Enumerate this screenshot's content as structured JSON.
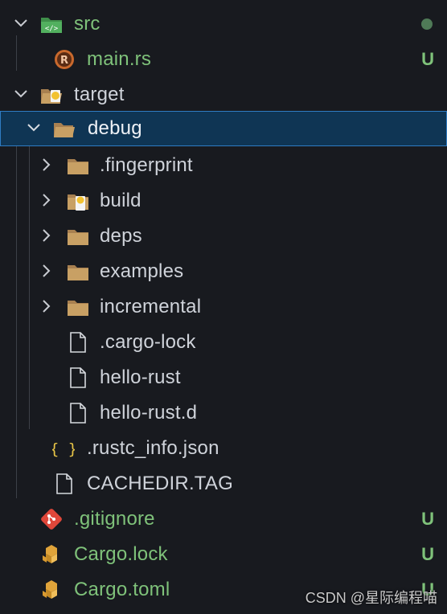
{
  "rows": [
    {
      "label": "src",
      "status": ""
    },
    {
      "label": "main.rs",
      "status": "U"
    },
    {
      "label": "target",
      "status": ""
    },
    {
      "label": "debug",
      "status": ""
    },
    {
      "label": ".fingerprint",
      "status": ""
    },
    {
      "label": "build",
      "status": ""
    },
    {
      "label": "deps",
      "status": ""
    },
    {
      "label": "examples",
      "status": ""
    },
    {
      "label": "incremental",
      "status": ""
    },
    {
      "label": ".cargo-lock",
      "status": ""
    },
    {
      "label": "hello-rust",
      "status": ""
    },
    {
      "label": "hello-rust.d",
      "status": ""
    },
    {
      "label": ".rustc_info.json",
      "status": ""
    },
    {
      "label": "CACHEDIR.TAG",
      "status": ""
    },
    {
      "label": ".gitignore",
      "status": "U"
    },
    {
      "label": "Cargo.lock",
      "status": "U"
    },
    {
      "label": "Cargo.toml",
      "status": "U"
    }
  ],
  "watermark": "CSDN @星际编程喵",
  "colors": {
    "background": "#181a1f",
    "selection": "#0f3554",
    "selection_border": "#2f7cc4",
    "untracked": "#7fc27a",
    "folder": "#c8a064"
  }
}
